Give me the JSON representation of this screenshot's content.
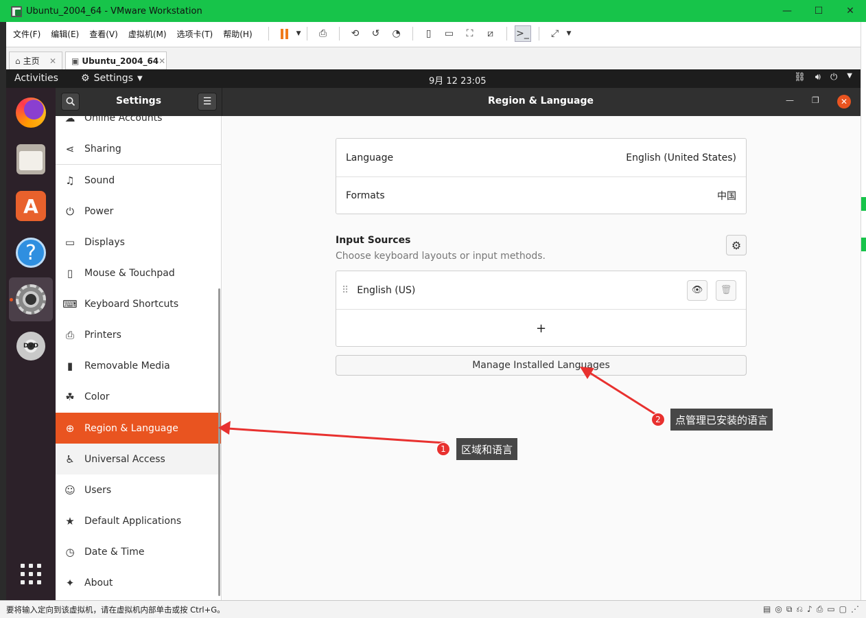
{
  "vmware": {
    "window_title": "Ubuntu_2004_64 - VMware Workstation",
    "menus": [
      "文件(F)",
      "编辑(E)",
      "查看(V)",
      "虚拟机(M)",
      "选项卡(T)",
      "帮助(H)"
    ],
    "tabs": [
      {
        "label": "主页",
        "icon": "home-icon"
      },
      {
        "label": "Ubuntu_2004_64",
        "icon": "vm-icon"
      }
    ],
    "status_message": "要将输入定向到该虚拟机，请在虚拟机内部单击或按 Ctrl+G。",
    "accent_color": "#17c44a"
  },
  "ubuntu": {
    "activities": "Activities",
    "app_menu": "Settings",
    "clock": "9月 12  23:05",
    "dock": [
      "firefox-icon",
      "files-icon",
      "software-icon",
      "help-icon",
      "settings-icon",
      "dvd-icon",
      "show-apps-icon"
    ]
  },
  "settings": {
    "sidebar_title": "Settings",
    "page_title": "Region & Language",
    "sidebar": [
      {
        "label": "Online Accounts",
        "icon": "cloud-icon"
      },
      {
        "label": "Sharing",
        "icon": "share-icon"
      },
      {
        "label": "Sound",
        "icon": "music-note-icon"
      },
      {
        "label": "Power",
        "icon": "power-icon"
      },
      {
        "label": "Displays",
        "icon": "display-icon"
      },
      {
        "label": "Mouse & Touchpad",
        "icon": "mouse-icon"
      },
      {
        "label": "Keyboard Shortcuts",
        "icon": "keyboard-icon"
      },
      {
        "label": "Printers",
        "icon": "printer-icon"
      },
      {
        "label": "Removable Media",
        "icon": "usb-icon"
      },
      {
        "label": "Color",
        "icon": "color-icon"
      },
      {
        "label": "Region & Language",
        "icon": "globe-icon",
        "selected": true
      },
      {
        "label": "Universal Access",
        "icon": "accessibility-icon"
      },
      {
        "label": "Users",
        "icon": "user-icon"
      },
      {
        "label": "Default Applications",
        "icon": "star-icon"
      },
      {
        "label": "Date & Time",
        "icon": "clock-icon"
      },
      {
        "label": "About",
        "icon": "info-sparkle-icon"
      }
    ],
    "language_label": "Language",
    "language_value": "English (United States)",
    "formats_label": "Formats",
    "formats_value": "中国",
    "input_sources_title": "Input Sources",
    "input_sources_subtitle": "Choose keyboard layouts or input methods.",
    "input_source": "English (US)",
    "add_label": "+",
    "manage_button": "Manage Installed Languages",
    "selected_color": "#e95420"
  },
  "annotations": [
    {
      "number": "1",
      "text": "区域和语言"
    },
    {
      "number": "2",
      "text": "点管理已安装的语言"
    }
  ]
}
